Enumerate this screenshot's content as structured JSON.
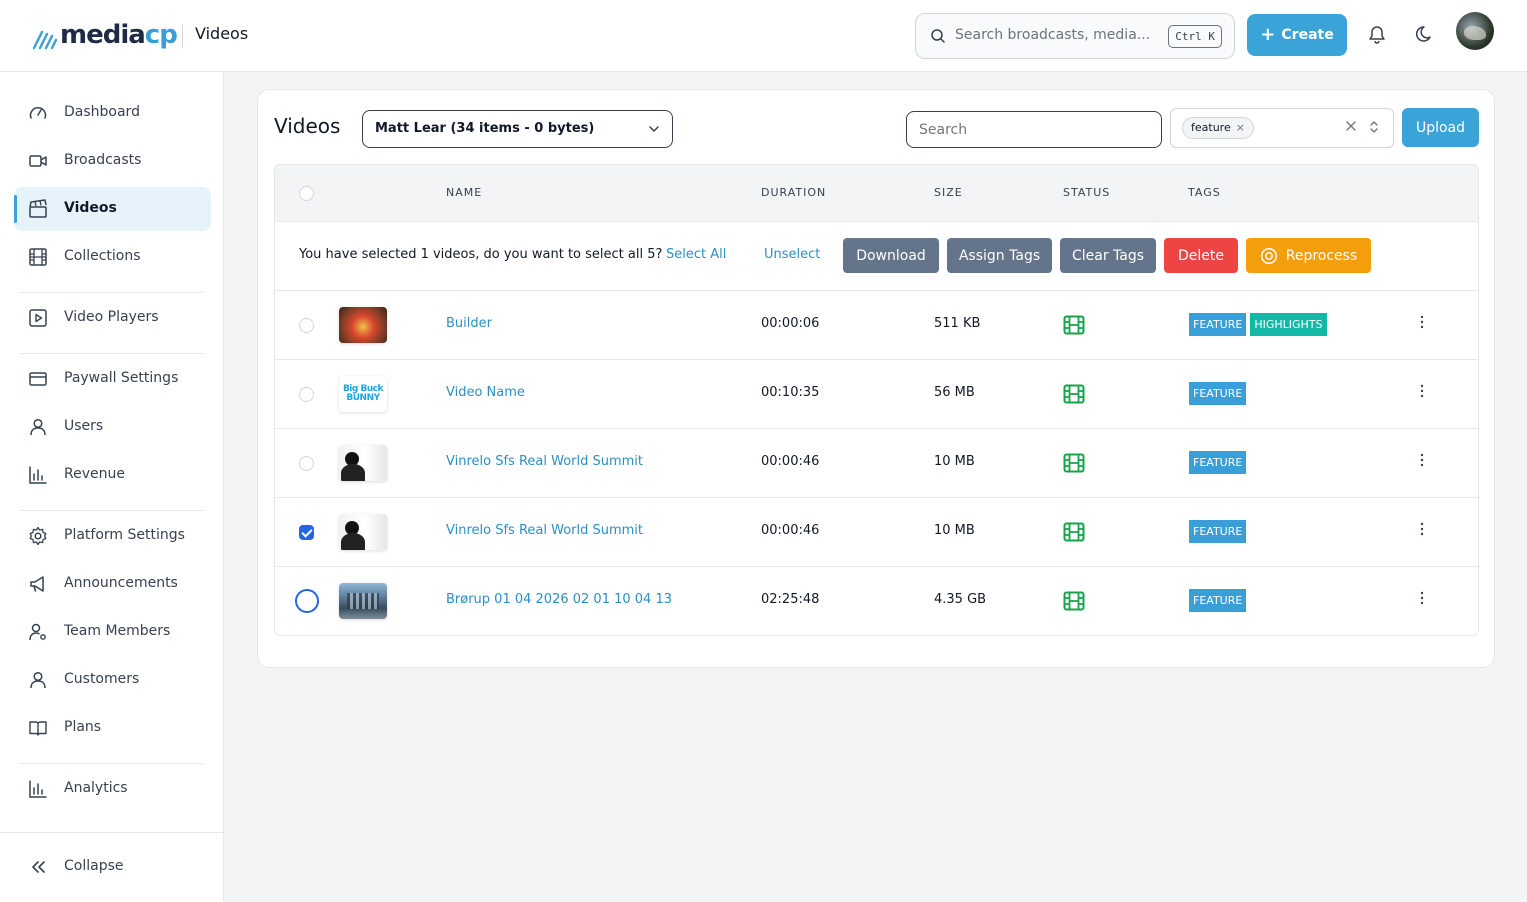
{
  "header": {
    "logo_main": "media",
    "logo_accent": "cp",
    "page_title": "Videos",
    "search_placeholder": "Search broadcasts, media...",
    "search_shortcut": "Ctrl K",
    "create_label": "Create"
  },
  "sidebar": {
    "items": [
      {
        "label": "Dashboard",
        "icon": "gauge-icon"
      },
      {
        "label": "Broadcasts",
        "icon": "video-camera-icon"
      },
      {
        "label": "Videos",
        "icon": "clapperboard-icon",
        "active": true
      },
      {
        "label": "Collections",
        "icon": "film-icon"
      },
      {
        "label": "Video Players",
        "icon": "play-square-icon"
      },
      {
        "label": "Paywall Settings",
        "icon": "credit-card-icon"
      },
      {
        "label": "Users",
        "icon": "user-icon"
      },
      {
        "label": "Revenue",
        "icon": "bar-chart-icon"
      },
      {
        "label": "Platform Settings",
        "icon": "gear-icon"
      },
      {
        "label": "Announcements",
        "icon": "megaphone-icon"
      },
      {
        "label": "Team Members",
        "icon": "user-cog-icon"
      },
      {
        "label": "Customers",
        "icon": "users-icon"
      },
      {
        "label": "Plans",
        "icon": "book-icon"
      },
      {
        "label": "Analytics",
        "icon": "bar-chart-icon"
      }
    ],
    "collapse_label": "Collapse"
  },
  "main": {
    "title": "Videos",
    "owner_select": "Matt Lear (34 items - 0 bytes)",
    "search_placeholder": "Search",
    "tag_filter": {
      "chip": "feature"
    },
    "upload_label": "Upload",
    "columns": [
      "NAME",
      "DURATION",
      "SIZE",
      "STATUS",
      "TAGS"
    ],
    "selection": {
      "message": "You have selected 1 videos, do you want to select all 5?",
      "select_all": "Select All",
      "unselect": "Unselect",
      "actions": [
        "Download",
        "Assign Tags",
        "Clear Tags",
        "Delete",
        "Reprocess"
      ]
    },
    "rows": [
      {
        "name": "Builder",
        "duration": "00:00:06",
        "size": "511 KB",
        "status_icon": "film-icon",
        "tags": [
          "FEATURE",
          "HIGHLIGHTS"
        ],
        "checked": false,
        "thumb": "builder"
      },
      {
        "name": "Video Name",
        "duration": "00:10:35",
        "size": "56 MB",
        "status_icon": "film-icon",
        "tags": [
          "FEATURE"
        ],
        "checked": false,
        "thumb": "bunny",
        "thumb_text": "Big Buck BUNNY"
      },
      {
        "name": "Vinrelo Sfs Real World Summit",
        "duration": "00:00:46",
        "size": "10 MB",
        "status_icon": "film-icon",
        "tags": [
          "FEATURE"
        ],
        "checked": false,
        "thumb": "person"
      },
      {
        "name": "Vinrelo Sfs Real World Summit",
        "duration": "00:00:46",
        "size": "10 MB",
        "status_icon": "film-icon",
        "tags": [
          "FEATURE"
        ],
        "checked": true,
        "thumb": "person"
      },
      {
        "name": "Brørup 01 04 2026 02 01 10 04 13",
        "duration": "02:25:48",
        "size": "4.35 GB",
        "status_icon": "film-icon",
        "tags": [
          "FEATURE"
        ],
        "checked": false,
        "thumb": "city"
      }
    ]
  },
  "colors": {
    "accent": "#3aa3d8",
    "link": "#2d8fc4",
    "status_ready": "#16a34a",
    "tag_feature": "#3a9fd8",
    "tag_highlights": "#14b8a6",
    "danger": "#ef4444",
    "warning": "#f59e0b"
  }
}
